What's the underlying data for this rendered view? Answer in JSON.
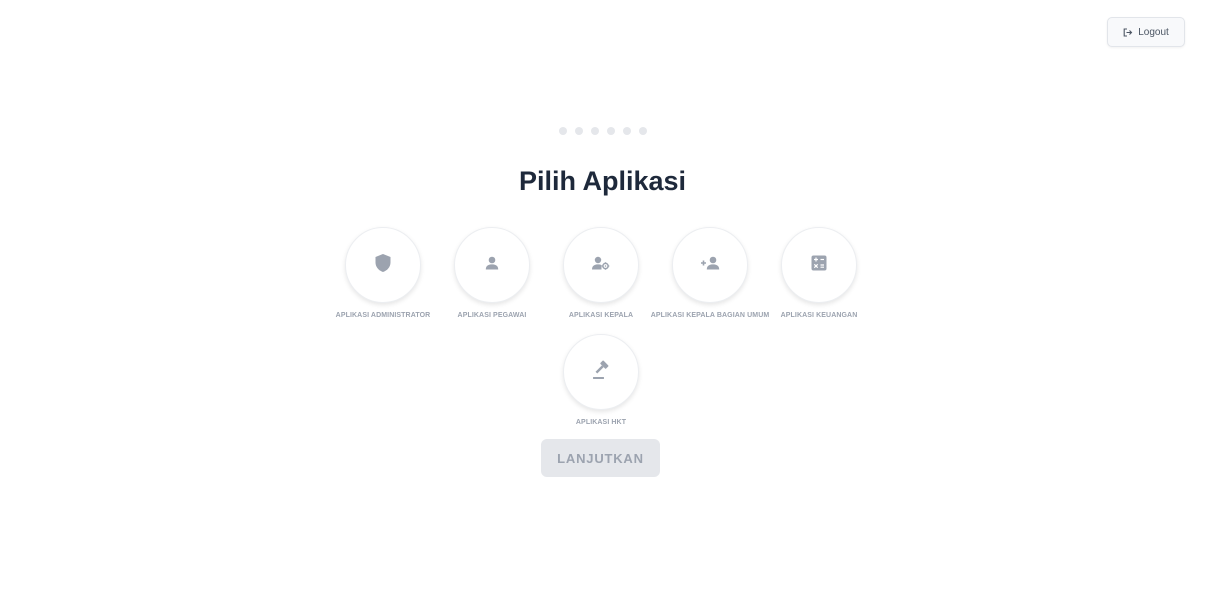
{
  "header": {
    "logout_label": "Logout",
    "logout_icon": "logout-icon"
  },
  "stepper": {
    "total_steps": 6
  },
  "title": "Pilih Aplikasi",
  "apps": [
    {
      "label": "APLIKASI ADMINISTRATOR",
      "icon": "shield-icon"
    },
    {
      "label": "APLIKASI PEGAWAI",
      "icon": "user-icon"
    },
    {
      "label": "APLIKASI KEPALA",
      "icon": "user-gear-icon"
    },
    {
      "label": "APLIKASI KEPALA BAGIAN UMUM",
      "icon": "user-plus-icon"
    },
    {
      "label": "APLIKASI KEUANGAN",
      "icon": "calculator-icon"
    },
    {
      "label": "APLIKASI HKT",
      "icon": "gavel-icon"
    }
  ],
  "continue_label": "LANJUTKAN",
  "colors": {
    "icon": "#9ca3af",
    "title": "#1e293b",
    "disabled_button_bg": "#e5e7eb",
    "disabled_button_text": "#9ca3af"
  }
}
